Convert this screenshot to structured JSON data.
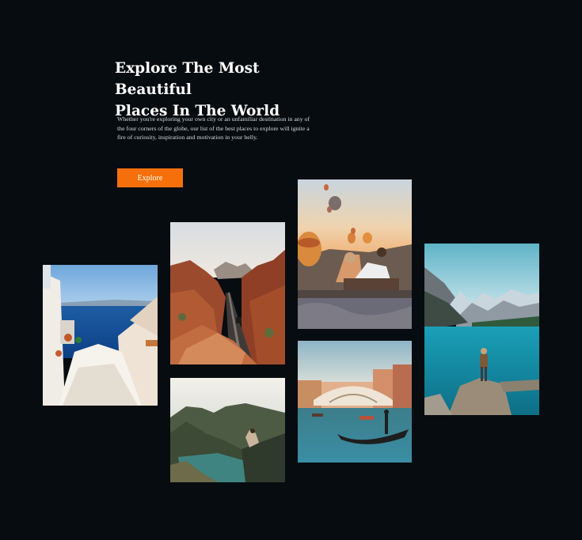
{
  "hero": {
    "title_line1": "Explore The Most Beautiful",
    "title_line2": "Places In The World",
    "description": "Whether you're exploring your own city or an unfamiliar destination in any of the four corners of  the globe, our list of  the best places to explore will ignite a fire of curiosity, inspiration and motivation in your belly.",
    "button_label": "Explore"
  },
  "colors": {
    "background": "#070c10",
    "accent": "#f5700a",
    "text": "#ffffff"
  },
  "gallery": [
    {
      "name": "santorini-photo",
      "subject": "whitewashed stairway over blue sea"
    },
    {
      "name": "canyon-road-photo",
      "subject": "desert canyon road with red rocks"
    },
    {
      "name": "coastline-photo",
      "subject": "person sitting above a green coastline"
    },
    {
      "name": "balloons-photo",
      "subject": "couple watching hot air balloons at sunrise"
    },
    {
      "name": "venice-photo",
      "subject": "gondola near the Rialto bridge"
    },
    {
      "name": "mountain-lake-photo",
      "subject": "hiker on rock above a turquoise mountain lake"
    }
  ]
}
